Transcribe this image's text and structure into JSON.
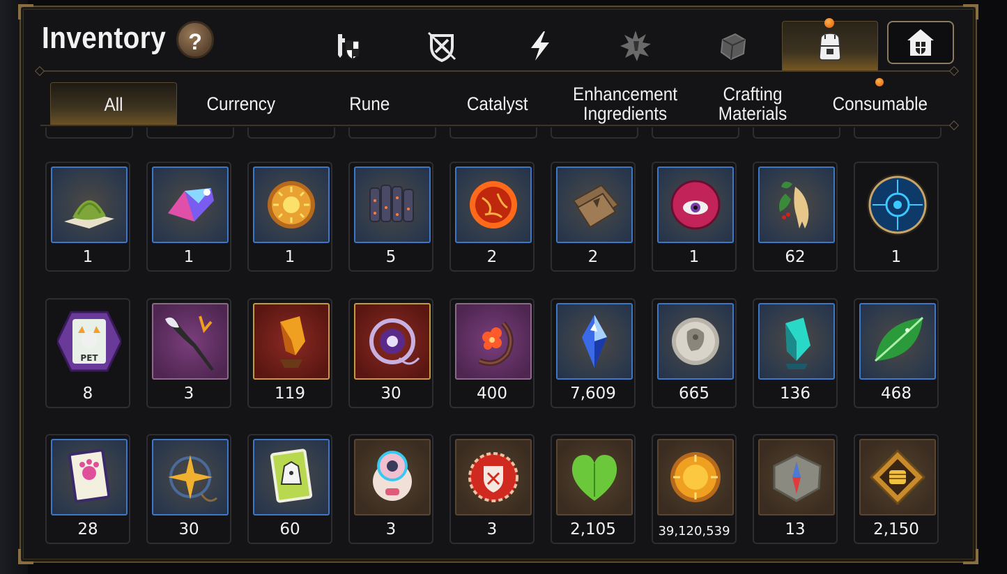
{
  "header": {
    "title": "Inventory",
    "help_label": "?"
  },
  "top_tabs": [
    {
      "icon": "knight-shield-icon"
    },
    {
      "icon": "broken-shield-icon"
    },
    {
      "icon": "lightning-icon"
    },
    {
      "icon": "burst-emblem-icon"
    },
    {
      "icon": "cube-icon"
    },
    {
      "icon": "backpack-icon",
      "active": true
    },
    {
      "icon": "guild-house-icon"
    }
  ],
  "sub_tabs": [
    "All",
    "Currency",
    "Rune",
    "Catalyst",
    "Enhancement Ingredients",
    "Crafting Materials",
    "Consumable"
  ],
  "active_sub_tab": "All",
  "items": [
    {
      "icon": "grass-pile-icon",
      "frame": "blue",
      "count": "1"
    },
    {
      "icon": "rainbow-crystal-icon",
      "frame": "blue",
      "count": "1"
    },
    {
      "icon": "sun-coin-icon",
      "frame": "blue",
      "count": "1"
    },
    {
      "icon": "dark-scales-icon",
      "frame": "blue",
      "count": "5"
    },
    {
      "icon": "fire-orb-icon",
      "frame": "blue",
      "count": "2"
    },
    {
      "icon": "leather-pouch-icon",
      "frame": "blue",
      "count": "2"
    },
    {
      "icon": "eye-orb-icon",
      "frame": "blue",
      "count": "1"
    },
    {
      "icon": "ginseng-root-icon",
      "frame": "blue",
      "count": "62"
    },
    {
      "icon": "blue-rune-seal-icon",
      "frame": "none",
      "count": "1"
    },
    {
      "icon": "pet-food-bag-icon",
      "frame": "none",
      "count": "8"
    },
    {
      "icon": "feather-wand-icon",
      "frame": "purple",
      "count": "3"
    },
    {
      "icon": "amber-crystal-icon",
      "frame": "gold",
      "count": "119"
    },
    {
      "icon": "star-pendant-icon",
      "frame": "gold",
      "count": "30"
    },
    {
      "icon": "flower-hook-icon",
      "frame": "purple",
      "count": "400"
    },
    {
      "icon": "blue-gem-icon",
      "frame": "blue",
      "count": "7,609"
    },
    {
      "icon": "silver-coin-icon",
      "frame": "blue",
      "count": "665"
    },
    {
      "icon": "teal-crystal-icon",
      "frame": "blue",
      "count": "136"
    },
    {
      "icon": "green-leaf-icon",
      "frame": "blue",
      "count": "468"
    },
    {
      "icon": "card-paw-icon",
      "frame": "blue",
      "count": "28"
    },
    {
      "icon": "compass-pendant-icon",
      "frame": "blue",
      "count": "30"
    },
    {
      "icon": "card-outfit-icon",
      "frame": "blue",
      "count": "60"
    },
    {
      "icon": "robot-pet-icon",
      "frame": "brown",
      "count": "3"
    },
    {
      "icon": "badge-shield-icon",
      "frame": "brown",
      "count": "3"
    },
    {
      "icon": "green-heart-icon",
      "frame": "brown",
      "count": "2,105"
    },
    {
      "icon": "gold-coin-icon",
      "frame": "brown",
      "count": "39,120,539"
    },
    {
      "icon": "stone-tablet-icon",
      "frame": "brown",
      "count": "13"
    },
    {
      "icon": "fist-emblem-icon",
      "frame": "brown",
      "count": "2,150"
    }
  ],
  "colors": {
    "accent": "#c8a050",
    "frame_blue": "#3d78c8",
    "notification": "#e35a08"
  }
}
